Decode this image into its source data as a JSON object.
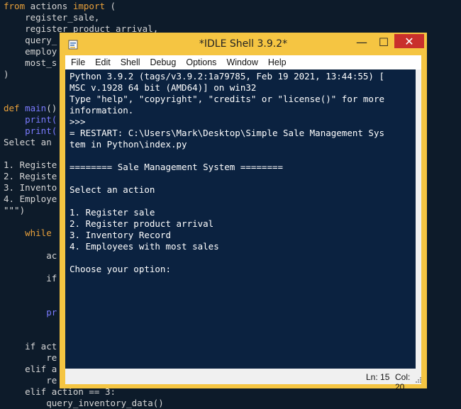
{
  "editor": {
    "lines": [
      {
        "kw": "from",
        "rest": " actions ",
        "kw2": "import",
        "rest2": " ("
      },
      {
        "text": "    register_sale,"
      },
      {
        "text": "    register_product_arrival,"
      },
      {
        "text": "    query_"
      },
      {
        "text": "    employ"
      },
      {
        "text": "    most_s"
      },
      {
        "text": ")"
      },
      {
        "text": ""
      },
      {
        "text": ""
      },
      {
        "kw": "def",
        "fn": " main",
        "rest": "()"
      },
      {
        "fnline": "    print("
      },
      {
        "fnline": "    print("
      },
      {
        "text": "Select an"
      },
      {
        "text": ""
      },
      {
        "text": "1. Registe"
      },
      {
        "text": "2. Registe"
      },
      {
        "text": "3. Invento"
      },
      {
        "text": "4. Employe"
      },
      {
        "text": "\"\"\")"
      },
      {
        "text": ""
      },
      {
        "kw": "    while",
        "rest": ""
      },
      {
        "text": ""
      },
      {
        "text": "        ac"
      },
      {
        "text": ""
      },
      {
        "text": "        if"
      },
      {
        "text": ""
      },
      {
        "text": ""
      },
      {
        "fnline": "        pr"
      },
      {
        "text": ""
      },
      {
        "text": ""
      },
      {
        "text": "    if act"
      },
      {
        "text": "        re"
      },
      {
        "text": "    elif a"
      },
      {
        "text": "        re"
      },
      {
        "text": "    elif action == 3:"
      },
      {
        "text": "        query_inventory_data()"
      }
    ]
  },
  "window": {
    "title": "*IDLE Shell 3.9.2*",
    "menu": [
      "File",
      "Edit",
      "Shell",
      "Debug",
      "Options",
      "Window",
      "Help"
    ],
    "minimize_glyph": "—",
    "maximize_glyph": "☐",
    "close_glyph": "✕"
  },
  "shell": {
    "lines": [
      "Python 3.9.2 (tags/v3.9.2:1a79785, Feb 19 2021, 13:44:55) [",
      "MSC v.1928 64 bit (AMD64)] on win32",
      "Type \"help\", \"copyright\", \"credits\" or \"license()\" for more",
      "information.",
      ">>> ",
      "= RESTART: C:\\Users\\Mark\\Desktop\\Simple Sale Management Sys",
      "tem in Python\\index.py",
      "",
      "======== Sale Management System ========",
      "",
      "Select an action",
      "",
      "1. Register sale",
      "2. Register product arrival",
      "3. Inventory Record",
      "4. Employees with most sales",
      "",
      "Choose your option: "
    ]
  },
  "status": {
    "ln": "Ln: 15",
    "col": "Col: 20"
  },
  "icons": {
    "app": "idle-app-icon",
    "grip": "resize-grip-icon"
  },
  "colors": {
    "window_frame": "#f5c542",
    "close_button": "#c9302c",
    "shell_bg": "#0b2240",
    "editor_bg": "#0d1b2a",
    "keyword": "#e8a03a",
    "function": "#7b7bff"
  }
}
